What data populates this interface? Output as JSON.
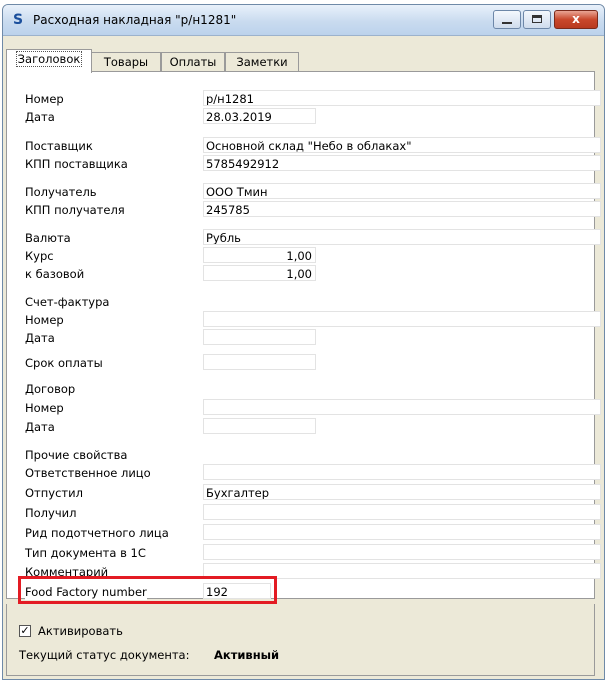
{
  "window": {
    "title": "Расходная накладная \"р/н1281\"",
    "icon_glyph": "S",
    "close_glyph": "x"
  },
  "tabs": [
    {
      "label": "Заголовок"
    },
    {
      "label": "Товары"
    },
    {
      "label": "Оплаты"
    },
    {
      "label": "Заметки"
    }
  ],
  "fields": {
    "number_label": "Номер",
    "number_value": "р/н1281",
    "date_label": "Дата",
    "date_value": "28.03.2019",
    "supplier_label": "Поставщик",
    "supplier_value": "Основной склад \"Небо в облаках\"",
    "supplier_kpp_label": "КПП поставщика",
    "supplier_kpp_value": "5785492912",
    "recipient_label": "Получатель",
    "recipient_value": "ООО Тмин",
    "recipient_kpp_label": "КПП получателя",
    "recipient_kpp_value": "245785",
    "currency_label": "Валюта",
    "currency_value": "Рубль",
    "rate_label": "Курс",
    "rate_value": "1,00",
    "base_label": "к базовой",
    "base_value": "1,00",
    "invoice_label": "Счет-фактура",
    "invoice_number_label": "Номер",
    "invoice_number_value": "",
    "invoice_date_label": "Дата",
    "invoice_date_value": "",
    "due_label": "Срок оплаты",
    "due_value": "",
    "contract_label": "Договор",
    "contract_number_label": "Номер",
    "contract_number_value": "",
    "contract_date_label": "Дата",
    "contract_date_value": "",
    "other_props_label": "Прочие свойства",
    "responsible_label": "Ответственное лицо",
    "responsible_value": "",
    "released_label": "Отпустил",
    "released_value": "Бухгалтер",
    "received_label": "Получил",
    "received_value": "",
    "accountable_type_label": "Рид подотчетного лица",
    "accountable_type_value": "",
    "doc_type_1c_label": "Тип документа в 1С",
    "doc_type_1c_value": "",
    "comment_label": "Комментарий",
    "comment_value": "",
    "food_factory_label": "Food Factory number",
    "food_factory_value": "192"
  },
  "status": {
    "activate_label": "Активировать",
    "activate_checked": true,
    "check_glyph": "✓",
    "doc_status_label": "Текущий статус документа:",
    "doc_status_value": "Активный"
  },
  "colors": {
    "highlight": "#e31b23",
    "accent": "#1a4f9c"
  }
}
